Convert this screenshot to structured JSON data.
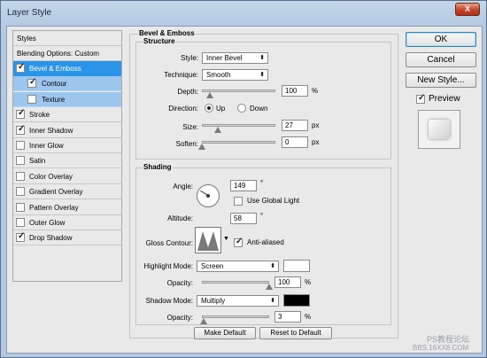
{
  "window": {
    "title": "Layer Style",
    "close_label": "X"
  },
  "styles_panel": {
    "header": "Styles",
    "blending_options": "Blending Options: Custom",
    "items": [
      {
        "label": "Bevel & Emboss",
        "checked": true
      },
      {
        "label": "Contour",
        "checked": true
      },
      {
        "label": "Texture",
        "checked": false
      },
      {
        "label": "Stroke",
        "checked": true
      },
      {
        "label": "Inner Shadow",
        "checked": true
      },
      {
        "label": "Inner Glow",
        "checked": false
      },
      {
        "label": "Satin",
        "checked": false
      },
      {
        "label": "Color Overlay",
        "checked": false
      },
      {
        "label": "Gradient Overlay",
        "checked": false
      },
      {
        "label": "Pattern Overlay",
        "checked": false
      },
      {
        "label": "Outer Glow",
        "checked": false
      },
      {
        "label": "Drop Shadow",
        "checked": true
      }
    ]
  },
  "bevel": {
    "title": "Bevel & Emboss",
    "structure": {
      "title": "Structure",
      "style_label": "Style:",
      "style_value": "Inner Bevel",
      "technique_label": "Technique:",
      "technique_value": "Smooth",
      "depth_label": "Depth:",
      "depth_value": "100",
      "depth_unit": "%",
      "direction_label": "Direction:",
      "up_label": "Up",
      "down_label": "Down",
      "direction_value": "Up",
      "size_label": "Size:",
      "size_value": "27",
      "size_unit": "px",
      "soften_label": "Soften:",
      "soften_value": "0",
      "soften_unit": "px"
    },
    "shading": {
      "title": "Shading",
      "angle_label": "Angle:",
      "angle_value": "149",
      "angle_unit": "°",
      "global_light_label": "Use Global Light",
      "global_light_checked": false,
      "altitude_label": "Altitude:",
      "altitude_value": "58",
      "altitude_unit": "°",
      "gloss_label": "Gloss Contour:",
      "anti_aliased_label": "Anti-aliased",
      "anti_aliased_checked": true,
      "highlight_mode_label": "Highlight Mode:",
      "highlight_mode_value": "Screen",
      "highlight_color": "#ffffff",
      "highlight_opacity_label": "Opacity:",
      "highlight_opacity_value": "100",
      "highlight_opacity_unit": "%",
      "shadow_mode_label": "Shadow Mode:",
      "shadow_mode_value": "Multiply",
      "shadow_color": "#000000",
      "shadow_opacity_label": "Opacity:",
      "shadow_opacity_value": "3",
      "shadow_opacity_unit": "%"
    },
    "make_default": "Make Default",
    "reset_default": "Reset to Default"
  },
  "buttons": {
    "ok": "OK",
    "cancel": "Cancel",
    "new_style": "New Style...",
    "preview": "Preview",
    "preview_checked": true
  },
  "watermark": {
    "line1": "PS教程论坛",
    "line2": "BBS.16XX8.COM"
  }
}
